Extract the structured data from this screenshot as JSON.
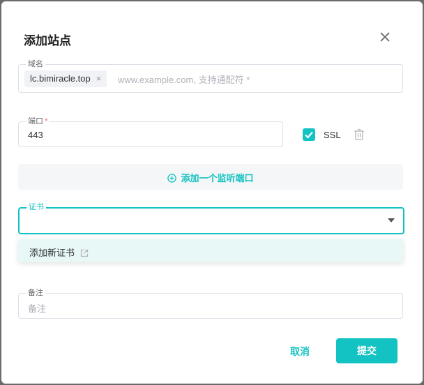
{
  "dialog": {
    "title": "添加站点",
    "close_icon": "close-icon"
  },
  "domain": {
    "label": "域名",
    "chip": "lc.bimiracle.top",
    "chip_remove": "×",
    "placeholder": "www.example.com, 支持通配符 *"
  },
  "port": {
    "label": "端口",
    "required_mark": "*",
    "value": "443",
    "ssl_label": "SSL",
    "ssl_checked": true
  },
  "add_port": {
    "icon": "plus-circle-icon",
    "label": "添加一个监听端口"
  },
  "certificate": {
    "label": "证书",
    "value": "",
    "options": [
      {
        "label": "添加新证书",
        "icon": "external-link-icon"
      }
    ]
  },
  "note": {
    "label": "备注",
    "placeholder": "备注"
  },
  "footer": {
    "cancel_label": "取消",
    "submit_label": "提交"
  },
  "colors": {
    "accent": "#13c2c2",
    "dropdown_bg": "#e8f8f7"
  }
}
